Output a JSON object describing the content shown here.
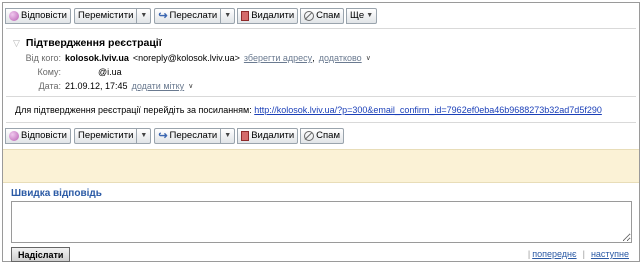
{
  "toolbar": {
    "reply": "Відповісти",
    "move": "Перемістити",
    "forward": "Переслати",
    "delete": "Видалити",
    "spam": "Спам",
    "more": "Ще"
  },
  "message": {
    "subject": "Підтвердження реєстрації",
    "from_label": "Від кого:",
    "from_name": "kolosok.lviv.ua",
    "from_email": "<noreply@kolosok.lviv.ua>",
    "save_address": "зберегти адресу",
    "more_link": "додатково",
    "to_label": "Кому:",
    "to_value": "@i.ua",
    "date_label": "Дата:",
    "date_value": "21.09.12, 17:45",
    "add_label": "додати мітку",
    "body_text": "Для підтвердження реєстрації перейдіть за посиланням:",
    "body_link": "http://kolosok.lviv.ua/?p=300&email_confirm_id=7962ef0eba46b9688273b32ad7d5f290"
  },
  "bottom_toolbar": {
    "reply": "Відповісти",
    "move": "Перемістити",
    "forward": "Переслати",
    "delete": "Видалити",
    "spam": "Спам"
  },
  "quick_reply": {
    "title": "Швидка відповідь",
    "input_value": "",
    "send": "Надіслати"
  },
  "pager": {
    "prev": "попереднє",
    "separator": "|",
    "next": "наступне"
  }
}
